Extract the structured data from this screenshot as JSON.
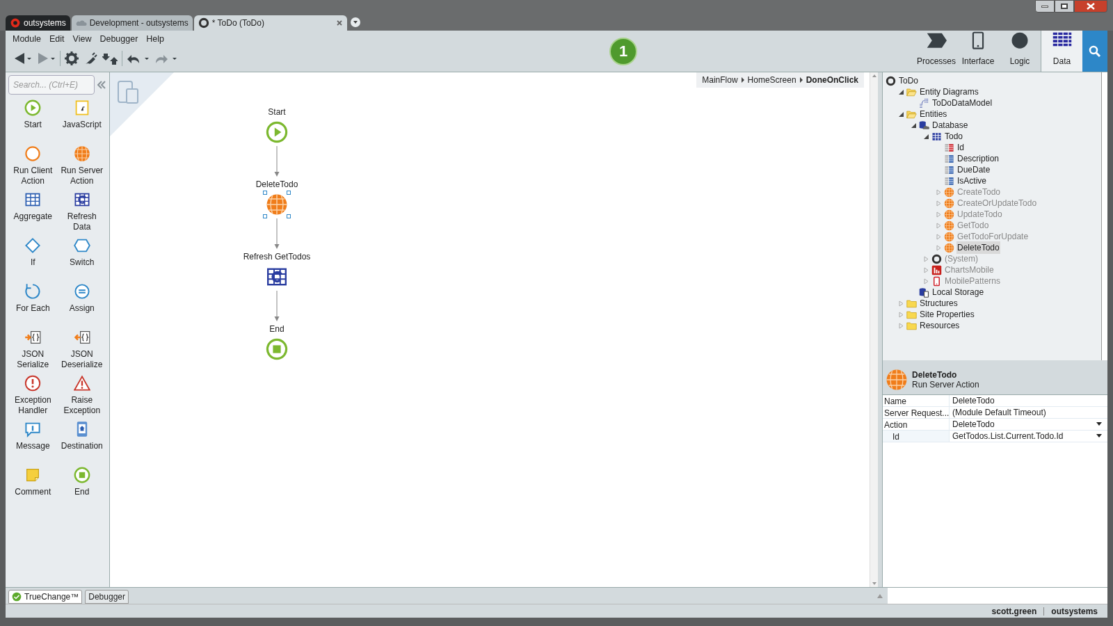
{
  "title_tabs": [
    {
      "label": "outsystems",
      "kind": "brand",
      "selected": false
    },
    {
      "label": "Development - outsystems",
      "kind": "cloud",
      "selected": false
    },
    {
      "label": "* ToDo (ToDo)",
      "kind": "module",
      "selected": true
    }
  ],
  "menu": [
    "Module",
    "Edit",
    "View",
    "Debugger",
    "Help"
  ],
  "issues_badge": "1",
  "app_tabs": [
    {
      "label": "Processes",
      "kind": "processes",
      "selected": false
    },
    {
      "label": "Interface",
      "kind": "interface",
      "selected": false
    },
    {
      "label": "Logic",
      "kind": "logic",
      "selected": false
    },
    {
      "label": "Data",
      "kind": "data",
      "selected": true
    }
  ],
  "toolbox": {
    "search": {
      "placeholder": "Search... (Ctrl+E)"
    },
    "items": [
      {
        "label": "Start",
        "kind": "start"
      },
      {
        "label": "JavaScript",
        "kind": "javascript"
      },
      {
        "label": "Run Client Action",
        "kind": "client-action"
      },
      {
        "label": "Run Server Action",
        "kind": "server-action"
      },
      {
        "label": "Aggregate",
        "kind": "aggregate"
      },
      {
        "label": "Refresh Data",
        "kind": "refresh"
      },
      {
        "label": "If",
        "kind": "if"
      },
      {
        "label": "Switch",
        "kind": "switch"
      },
      {
        "label": "For Each",
        "kind": "foreach"
      },
      {
        "label": "Assign",
        "kind": "assign"
      },
      {
        "label": "JSON Serialize",
        "kind": "json-serialize"
      },
      {
        "label": "JSON Deserialize",
        "kind": "json-deserialize"
      },
      {
        "label": "Exception Handler",
        "kind": "exception"
      },
      {
        "label": "Raise Exception",
        "kind": "raise"
      },
      {
        "label": "Message",
        "kind": "message"
      },
      {
        "label": "Destination",
        "kind": "destination"
      },
      {
        "label": "Comment",
        "kind": "comment"
      },
      {
        "label": "End",
        "kind": "end"
      }
    ]
  },
  "breadcrumb": [
    "MainFlow",
    "HomeScreen",
    "DoneOnClick"
  ],
  "flow": [
    {
      "label": "Start",
      "kind": "start",
      "selected": false
    },
    {
      "label": "DeleteTodo",
      "kind": "server-action",
      "selected": true
    },
    {
      "label": "Refresh GetTodos",
      "kind": "refresh",
      "selected": false
    },
    {
      "label": "End",
      "kind": "end",
      "selected": false
    }
  ],
  "tree": [
    {
      "label": "ToDo",
      "kind": "module",
      "children": [
        {
          "label": "Entity Diagrams",
          "kind": "folder-open",
          "expanded": true,
          "children": [
            {
              "label": "ToDoDataModel",
              "kind": "diagram"
            }
          ]
        },
        {
          "label": "Entities",
          "kind": "folder-open",
          "expanded": true,
          "children": [
            {
              "label": "Database",
              "kind": "database",
              "expanded": true,
              "children": [
                {
                  "label": "Todo",
                  "kind": "entity",
                  "expanded": true,
                  "children": [
                    {
                      "label": "Id",
                      "kind": "id-attribute"
                    },
                    {
                      "label": "Description",
                      "kind": "attribute"
                    },
                    {
                      "label": "DueDate",
                      "kind": "attribute"
                    },
                    {
                      "label": "IsActive",
                      "kind": "attribute"
                    },
                    {
                      "label": "CreateTodo",
                      "kind": "server-action",
                      "expanded": false,
                      "dimmed": true,
                      "selected": false
                    },
                    {
                      "label": "CreateOrUpdateTodo",
                      "kind": "server-action",
                      "expanded": false,
                      "dimmed": true,
                      "selected": false
                    },
                    {
                      "label": "UpdateTodo",
                      "kind": "server-action",
                      "expanded": false,
                      "dimmed": true,
                      "selected": false
                    },
                    {
                      "label": "GetTodo",
                      "kind": "server-action",
                      "expanded": false,
                      "dimmed": true,
                      "selected": false
                    },
                    {
                      "label": "GetTodoForUpdate",
                      "kind": "server-action",
                      "expanded": false,
                      "dimmed": true,
                      "selected": false
                    },
                    {
                      "label": "DeleteTodo",
                      "kind": "server-action",
                      "expanded": false,
                      "dimmed": false,
                      "selected": true
                    }
                  ]
                },
                {
                  "label": "(System)",
                  "kind": "module",
                  "expanded": false,
                  "dimmed": true
                },
                {
                  "label": "ChartsMobile",
                  "kind": "charts",
                  "expanded": false,
                  "dimmed": true
                },
                {
                  "label": "MobilePatterns",
                  "kind": "phone",
                  "expanded": false,
                  "dimmed": true
                }
              ]
            },
            {
              "label": "Local Storage",
              "kind": "local-storage"
            }
          ]
        },
        {
          "label": "Structures",
          "kind": "folder",
          "expanded": false
        },
        {
          "label": "Site Properties",
          "kind": "folder",
          "expanded": false
        },
        {
          "label": "Resources",
          "kind": "folder",
          "expanded": false
        }
      ]
    }
  ],
  "properties": {
    "name": "DeleteTodo",
    "type": "Run Server Action",
    "rows": [
      {
        "name": "Name",
        "value": "DeleteTodo",
        "dropdown": false,
        "indented": false
      },
      {
        "name": "Server Request...",
        "value": "(Module Default Timeout)",
        "dropdown": false,
        "indented": false
      },
      {
        "name": "Action",
        "value": "DeleteTodo",
        "dropdown": true,
        "indented": false
      },
      {
        "name": "Id",
        "value": "GetTodos.List.Current.Todo.Id",
        "dropdown": true,
        "indented": true
      }
    ]
  },
  "bottom_tabs": [
    {
      "label": "TrueChange™",
      "kind": "truechange",
      "selected": true
    },
    {
      "label": "Debugger",
      "kind": "plain",
      "selected": false
    }
  ],
  "status_bar": {
    "user": "scott.green",
    "environment": "outsystems"
  }
}
